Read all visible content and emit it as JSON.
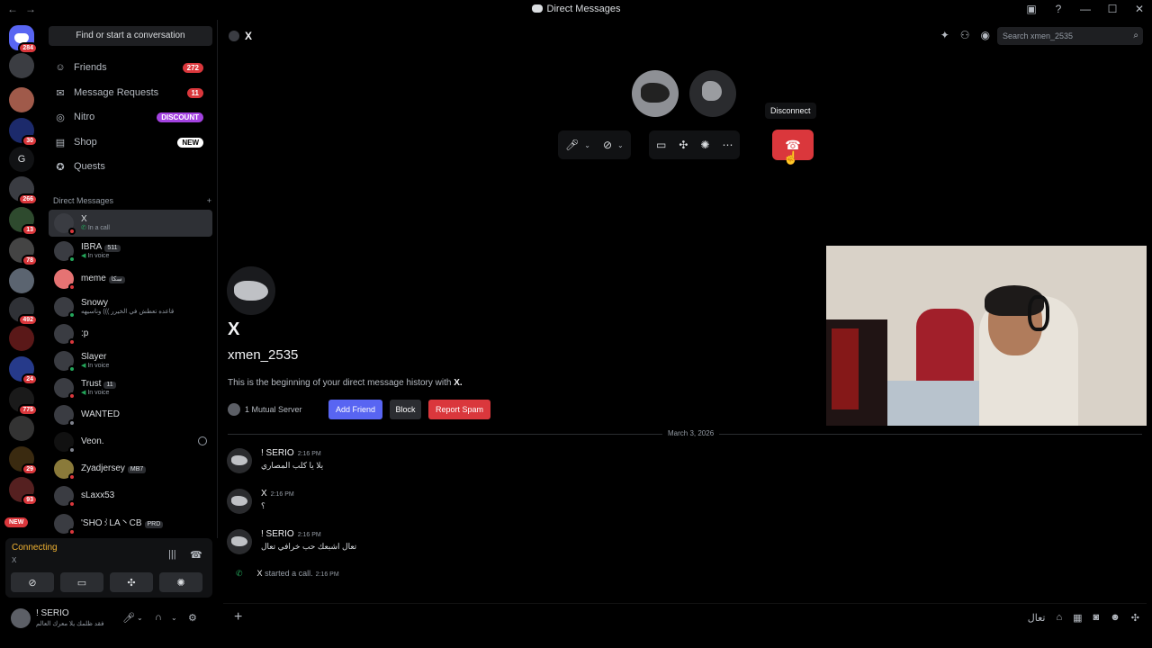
{
  "window": {
    "title": "Direct Messages"
  },
  "servers": {
    "badges": [
      "284",
      "30",
      "266",
      "13",
      "78",
      "492",
      "24",
      "775",
      "29",
      "93"
    ],
    "letter": "G",
    "new_label": "NEW"
  },
  "sidebar": {
    "find_placeholder": "Find or start a conversation",
    "nav": [
      {
        "label": "Friends",
        "badge": "272",
        "icon": "friends-icon"
      },
      {
        "label": "Message Requests",
        "badge": "11",
        "icon": "mail-icon"
      },
      {
        "label": "Nitro",
        "badge": "DISCOUNT",
        "icon": "nitro-icon"
      },
      {
        "label": "Shop",
        "badge": "NEW",
        "icon": "shop-icon"
      },
      {
        "label": "Quests",
        "badge": "",
        "icon": "quests-icon"
      }
    ],
    "dm_header": "Direct Messages",
    "dm_add": "+",
    "dms": [
      {
        "name": "X",
        "tag": "",
        "sub": "In a call",
        "status": "dnd"
      },
      {
        "name": "IBRA",
        "tag": "511",
        "sub": "In voice",
        "status": "online"
      },
      {
        "name": "meme",
        "tag": "سكا",
        "sub": "",
        "status": "dnd"
      },
      {
        "name": "Snowy",
        "tag": "",
        "sub": "قاعده تعطش في الخيرر ))) وناسيهه",
        "status": "online"
      },
      {
        "name": ":p",
        "tag": "",
        "sub": "",
        "status": "dnd"
      },
      {
        "name": "Slayer",
        "tag": "",
        "sub": "In voice",
        "status": "online"
      },
      {
        "name": "Trust",
        "tag": "11",
        "sub": "In voice",
        "status": "dnd"
      },
      {
        "name": "WANTED",
        "tag": "",
        "sub": "",
        "status": "offline"
      },
      {
        "name": "Veon.",
        "tag": "",
        "sub": "",
        "status": "offline"
      },
      {
        "name": "Zyadjersey",
        "tag": "MB7",
        "sub": "",
        "status": "dnd"
      },
      {
        "name": "sLaxx53",
        "tag": "",
        "sub": "",
        "status": "dnd"
      },
      {
        "name": "'SHO꒱LA丶CB",
        "tag": "PRD",
        "sub": "",
        "status": "dnd"
      }
    ]
  },
  "voice": {
    "status": "Connecting",
    "channel": "X"
  },
  "user": {
    "name": "! SERIO",
    "status": "فقد ظلمك يلا معرك العالم"
  },
  "header": {
    "title": "X",
    "search_placeholder": "Search xmen_2535"
  },
  "call": {
    "tooltip": "Disconnect"
  },
  "profile": {
    "display_name": "X",
    "username": "xmen_2535",
    "beginning_prefix": "This is the beginning of your direct message history with ",
    "beginning_name": "X.",
    "mutual": "1 Mutual Server",
    "add_friend": "Add Friend",
    "block": "Block",
    "report": "Report Spam"
  },
  "date_divider": "March 3, 2026",
  "messages": [
    {
      "author": "! SERIO",
      "time": "2:16 PM",
      "text": "يلا يا كلب المصاري"
    },
    {
      "author": "X",
      "time": "2:16 PM",
      "text": "؟"
    },
    {
      "author": "! SERIO",
      "time": "2:16 PM",
      "text": "تعال اشبعك حب خرافي تعال"
    }
  ],
  "call_event": {
    "author": "X",
    "text": "started a call.",
    "time": "2:16 PM"
  },
  "composer": {
    "right_text": "تعال"
  }
}
